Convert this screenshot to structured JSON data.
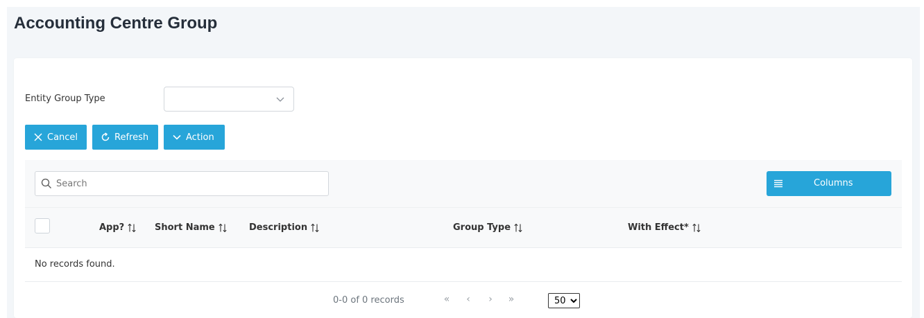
{
  "page": {
    "title": "Accounting Centre Group"
  },
  "filter": {
    "label": "Entity Group Type",
    "value": ""
  },
  "toolbar": {
    "cancel_label": "Cancel",
    "refresh_label": "Refresh",
    "action_label": "Action"
  },
  "table": {
    "search_placeholder": "Search",
    "columns_label": "Columns",
    "headers": [
      "App?",
      "Short Name",
      "Description",
      "Group Type",
      "With Effect*"
    ],
    "empty_message": "No records found."
  },
  "pagination": {
    "summary": "0-0 of 0 records",
    "first": "«",
    "prev": "‹",
    "next": "›",
    "last": "»",
    "per_page": "50",
    "per_page_options": [
      "50"
    ]
  },
  "icons": {
    "cancel": "close-icon",
    "refresh": "refresh-icon",
    "action": "chevron-down-icon",
    "search": "search-icon",
    "columns": "list-icon",
    "sort": "sort-icon"
  },
  "colors": {
    "accent": "#27a5d9",
    "page_background": "#f3f6f9",
    "title": "#252e3a"
  }
}
